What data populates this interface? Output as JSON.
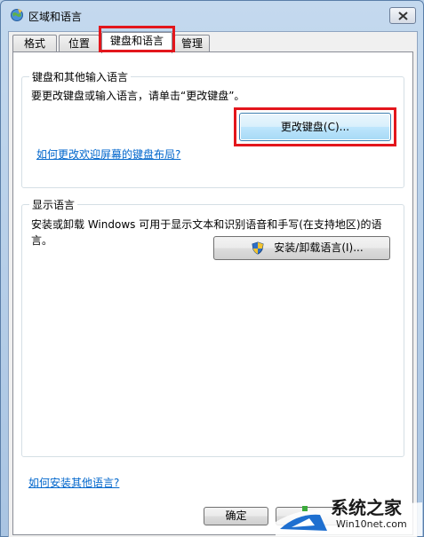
{
  "window": {
    "title": "区域和语言"
  },
  "tabs": [
    {
      "label": "格式"
    },
    {
      "label": "位置"
    },
    {
      "label": "键盘和语言",
      "active": true
    },
    {
      "label": "管理"
    }
  ],
  "keyboard_group": {
    "label": "键盘和其他输入语言",
    "description": "要更改键盘或输入语言，请单击“更改键盘”。",
    "change_button": "更改键盘(C)...",
    "welcome_link": "如何更改欢迎屏幕的键盘布局?"
  },
  "display_group": {
    "label": "显示语言",
    "description_line1": "安装或卸载 Windows 可用于显示文本和识别语音和手写(在支持地区)的语",
    "description_line2": "言。",
    "install_button": "安装/卸载语言(I)..."
  },
  "footer": {
    "install_link": "如何安装其他语言?",
    "ok_button": "确定"
  },
  "watermark": {
    "brand": "系统之家",
    "url": "Win10net.com"
  },
  "colors": {
    "highlight": "#e3161c",
    "link": "#0066cc",
    "focus": "#3c7fb1"
  }
}
